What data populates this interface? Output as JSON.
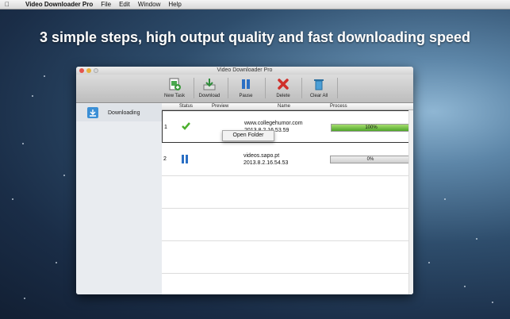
{
  "menubar": {
    "app": "Video Downloader Pro",
    "items": [
      "File",
      "Edit",
      "Window",
      "Help"
    ]
  },
  "headline": "3 simple steps, high output quality and fast downloading speed",
  "window": {
    "title": "Video Downloader Pro"
  },
  "toolbar": {
    "new_task": "New Task",
    "download": "Download",
    "pause": "Pause",
    "delete": "Delete",
    "clear_all": "Clear All"
  },
  "sidebar": {
    "items": [
      {
        "label": "Downloading",
        "icon": "download-icon"
      }
    ]
  },
  "table": {
    "columns": [
      "Status",
      "Preview",
      "Name",
      "Process"
    ],
    "rows": [
      {
        "num": "1",
        "status_icon": "checkmark-icon",
        "name": "www.collegehumor.com",
        "time": "2013.8.2.16.53.59",
        "progress": 1.0,
        "progress_label": "100%"
      },
      {
        "num": "2",
        "status_icon": "pause-icon",
        "name": "videos.sapo.pt",
        "time": "2013.8.2.16.54.53",
        "progress": 0.0,
        "progress_label": "0%"
      }
    ]
  },
  "context_menu": {
    "item": "Open Folder"
  },
  "colors": {
    "progress_fill": "#5cb437",
    "status_pause": "#2a6fc4",
    "status_check": "#4caf2e",
    "delete": "#d0302b"
  }
}
